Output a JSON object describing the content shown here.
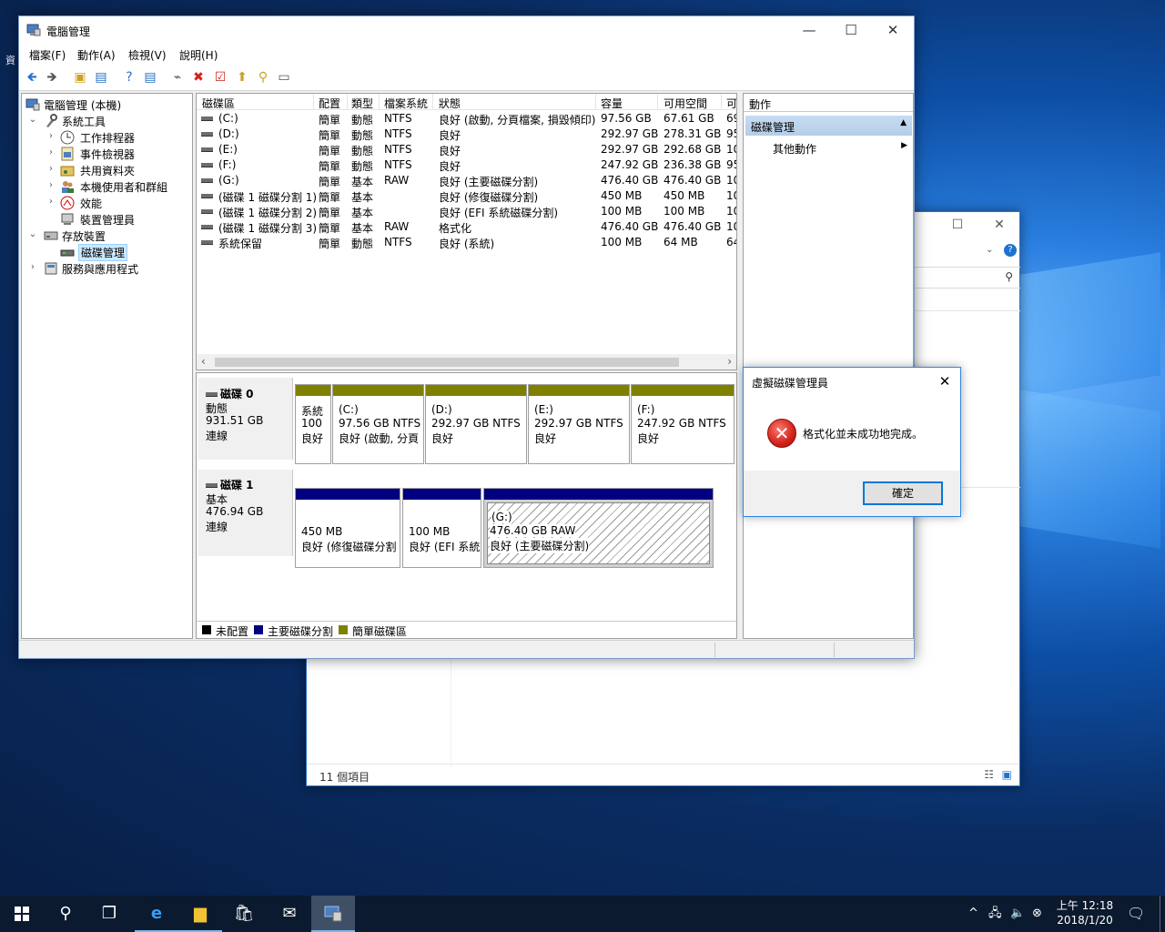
{
  "desktop": {
    "fragments": [
      "資"
    ]
  },
  "explorer": {
    "item_count": "11 個項目"
  },
  "window": {
    "title": "電腦管理",
    "menus": [
      "檔案(F)",
      "動作(A)",
      "檢視(V)",
      "說明(H)"
    ]
  },
  "tree": {
    "root": "電腦管理 (本機)",
    "system_tools": "系統工具",
    "task_scheduler": "工作排程器",
    "event_viewer": "事件檢視器",
    "shared_folders": "共用資料夾",
    "local_users": "本機使用者和群組",
    "performance": "效能",
    "device_manager": "裝置管理員",
    "storage": "存放裝置",
    "disk_management": "磁碟管理",
    "services": "服務與應用程式"
  },
  "volume_list": {
    "headers": [
      "磁碟區",
      "配置",
      "類型",
      "檔案系統",
      "狀態",
      "容量",
      "可用空間",
      "可"
    ],
    "rows": [
      [
        "(C:)",
        "簡單",
        "動態",
        "NTFS",
        "良好 (啟動, 分頁檔案, 損毀傾印)",
        "97.56 GB",
        "67.61 GB",
        "69"
      ],
      [
        "(D:)",
        "簡單",
        "動態",
        "NTFS",
        "良好",
        "292.97 GB",
        "278.31 GB",
        "95"
      ],
      [
        "(E:)",
        "簡單",
        "動態",
        "NTFS",
        "良好",
        "292.97 GB",
        "292.68 GB",
        "10"
      ],
      [
        "(F:)",
        "簡單",
        "動態",
        "NTFS",
        "良好",
        "247.92 GB",
        "236.38 GB",
        "95"
      ],
      [
        "(G:)",
        "簡單",
        "基本",
        "RAW",
        "良好 (主要磁碟分割)",
        "476.40 GB",
        "476.40 GB",
        "10"
      ],
      [
        "(磁碟 1 磁碟分割 1)",
        "簡單",
        "基本",
        "",
        "良好 (修復磁碟分割)",
        "450 MB",
        "450 MB",
        "10"
      ],
      [
        "(磁碟 1 磁碟分割 2)",
        "簡單",
        "基本",
        "",
        "良好 (EFI 系統磁碟分割)",
        "100 MB",
        "100 MB",
        "10"
      ],
      [
        "(磁碟 1 磁碟分割 3)",
        "簡單",
        "基本",
        "RAW",
        "格式化",
        "476.40 GB",
        "476.40 GB",
        "10"
      ],
      [
        "系統保留",
        "簡單",
        "動態",
        "NTFS",
        "良好 (系統)",
        "100 MB",
        "64 MB",
        "64"
      ]
    ]
  },
  "disks": {
    "disk0": {
      "name": "磁碟 0",
      "type": "動態",
      "size": "931.51 GB",
      "status": "連線",
      "partitions": [
        {
          "l1": "系統",
          "l2": "100",
          "l3": "良好"
        },
        {
          "l1": "(C:)",
          "l2": "97.56 GB NTFS",
          "l3": "良好 (啟動, 分頁"
        },
        {
          "l1": "(D:)",
          "l2": "292.97 GB NTFS",
          "l3": "良好"
        },
        {
          "l1": "(E:)",
          "l2": "292.97 GB NTFS",
          "l3": "良好"
        },
        {
          "l1": "(F:)",
          "l2": "247.92 GB NTFS",
          "l3": "良好"
        }
      ]
    },
    "disk1": {
      "name": "磁碟 1",
      "type": "基本",
      "size": "476.94 GB",
      "status": "連線",
      "partitions": [
        {
          "l1": "450 MB",
          "l2": "良好 (修復磁碟分割"
        },
        {
          "l1": "100 MB",
          "l2": "良好 (EFI 系統"
        },
        {
          "l1": "(G:)",
          "l2": "476.40 GB RAW",
          "l3": "良好 (主要磁碟分割)"
        }
      ]
    }
  },
  "legend": {
    "unallocated": "未配置",
    "primary": "主要磁碟分割",
    "simple": "簡單磁碟區"
  },
  "colors": {
    "simple_volume": "#808000",
    "primary_partition": "#000080",
    "unallocated": "#000000"
  },
  "actions": {
    "title": "動作",
    "section": "磁碟管理",
    "more": "其他動作"
  },
  "dialog": {
    "title": "虛擬磁碟管理員",
    "message": "格式化並未成功地完成。",
    "ok": "確定"
  },
  "taskbar": {
    "time": "上午 12:18",
    "date": "2018/1/20"
  }
}
